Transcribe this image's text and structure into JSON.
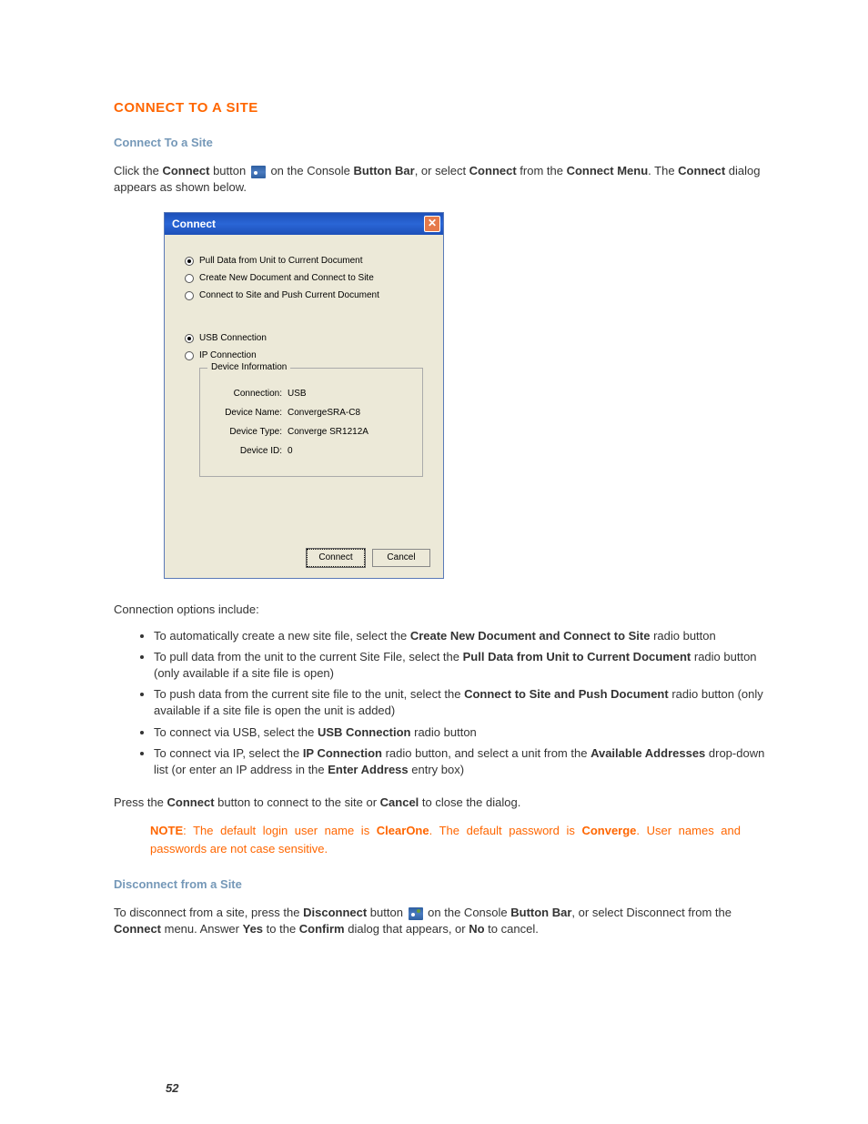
{
  "heading": "CONNECT TO A SITE",
  "sections": {
    "connect": {
      "title": "Connect To a Site",
      "intro_parts": [
        "Click the ",
        "Connect",
        " button ",
        " on the Console ",
        "Button Bar",
        ", or select ",
        "Connect",
        " from the ",
        "Connect Menu",
        ". The ",
        "Connect",
        " dialog appears as shown below."
      ],
      "options_intro": "Connection options include:",
      "bullets": [
        {
          "pre": "To automatically create a new site file, select the ",
          "b": "Create New Document and Connect to Site",
          "post": " radio button"
        },
        {
          "pre": "To pull data from the unit to the current Site File, select the ",
          "b": "Pull Data from Unit to Current Document",
          "post": " radio button (only available if a site file is open)"
        },
        {
          "pre": "To push data from the current site file to the unit, select the ",
          "b": "Connect to Site and Push Document",
          "post": " radio button (only available if a site file is open the unit is added)"
        },
        {
          "pre": "To connect via USB, select the ",
          "b": "USB Connection",
          "post": " radio button"
        },
        {
          "pre": "To connect via IP, select the ",
          "b": "IP Connection",
          "post": " radio button, and select a unit from the ",
          "b2": "Available Addresses",
          "post2": " drop-down list (or enter an IP address in the ",
          "b3": "Enter Address",
          "post3": " entry box)"
        }
      ],
      "press_line_parts": [
        "Press the ",
        "Connect",
        " button to connect to the site or ",
        "Cancel",
        " to close the dialog."
      ],
      "note_parts": [
        "NOTE",
        ": The default login user name is ",
        "ClearOne",
        ". The default password is ",
        "Converge",
        ". User names and passwords are not case sensitive."
      ]
    },
    "disconnect": {
      "title": "Disconnect from a Site",
      "parts": [
        "To disconnect from a site, press the ",
        "Disconnect",
        " button ",
        " on the Console ",
        "Button Bar",
        ", or select Disconnect from the ",
        "Connect",
        " menu. Answer ",
        "Yes",
        " to the ",
        "Confirm",
        " dialog that appears, or ",
        "No",
        " to cancel."
      ]
    }
  },
  "dialog": {
    "title": "Connect",
    "doc_options": [
      {
        "label": "Pull Data from Unit to Current Document",
        "selected": true
      },
      {
        "label": "Create New Document and Connect to Site",
        "selected": false
      },
      {
        "label": "Connect to Site and Push Current Document",
        "selected": false
      }
    ],
    "conn_options": [
      {
        "label": "USB Connection",
        "selected": true
      },
      {
        "label": "IP Connection",
        "selected": false
      }
    ],
    "fieldset_legend": "Device Information",
    "info": {
      "connection_label": "Connection:",
      "connection_value": "USB",
      "name_label": "Device Name:",
      "name_value": "ConvergeSRA-C8",
      "type_label": "Device Type:",
      "type_value": "Converge SR1212A",
      "id_label": "Device ID:",
      "id_value": "0"
    },
    "buttons": {
      "connect": "Connect",
      "cancel": "Cancel"
    }
  },
  "page_number": "52"
}
